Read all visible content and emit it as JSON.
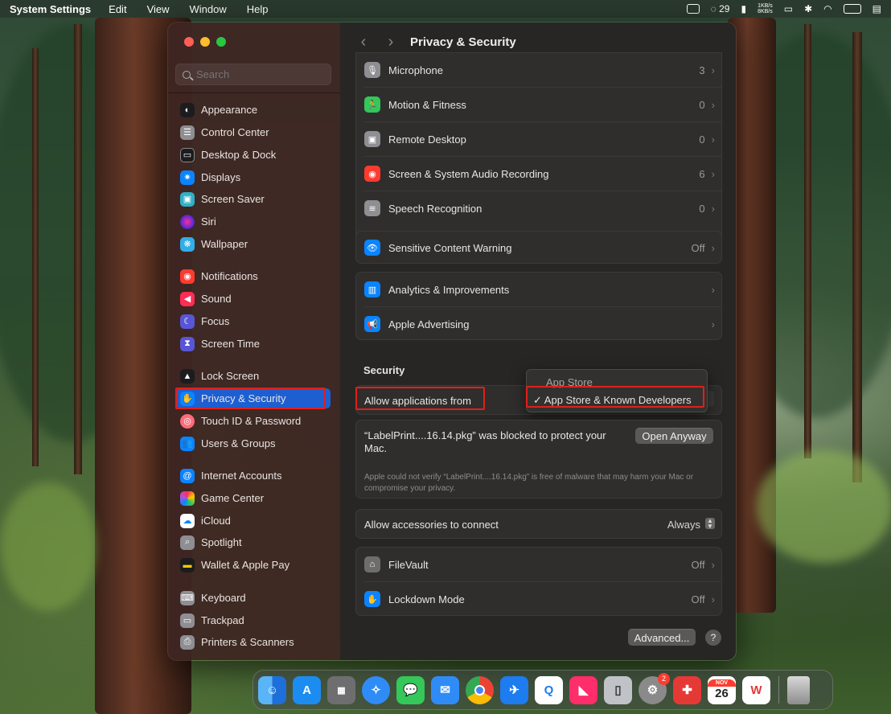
{
  "menubar": {
    "app": "System Settings",
    "menus": [
      "Edit",
      "View",
      "Window",
      "Help"
    ],
    "notif_count": "29",
    "net_up": "1KB/s",
    "net_down": "8KB/s"
  },
  "window": {
    "title": "Privacy & Security"
  },
  "sidebar": {
    "search_placeholder": "Search",
    "items": [
      {
        "label": "Appearance",
        "icon": "appearance-icon",
        "color": "#1c1c1e"
      },
      {
        "label": "Control Center",
        "icon": "control-center-icon",
        "color": "#8e8e93"
      },
      {
        "label": "Desktop & Dock",
        "icon": "desktop-dock-icon",
        "color": "#1c1c1e"
      },
      {
        "label": "Displays",
        "icon": "displays-icon",
        "color": "#0a84ff"
      },
      {
        "label": "Screen Saver",
        "icon": "screen-saver-icon",
        "color": "#30b0c7"
      },
      {
        "label": "Siri",
        "icon": "siri-icon",
        "color": "#5e2bd8"
      },
      {
        "label": "Wallpaper",
        "icon": "wallpaper-icon",
        "color": "#32ade6"
      },
      {
        "label": "Notifications",
        "icon": "notifications-icon",
        "color": "#ff3b30"
      },
      {
        "label": "Sound",
        "icon": "sound-icon",
        "color": "#ff2d55"
      },
      {
        "label": "Focus",
        "icon": "focus-icon",
        "color": "#5856d6"
      },
      {
        "label": "Screen Time",
        "icon": "screen-time-icon",
        "color": "#5856d6"
      },
      {
        "label": "Lock Screen",
        "icon": "lock-screen-icon",
        "color": "#1c1c1e"
      },
      {
        "label": "Privacy & Security",
        "icon": "privacy-hand-icon",
        "color": "#0a84ff"
      },
      {
        "label": "Touch ID & Password",
        "icon": "touch-id-icon",
        "color": "#ff6b7a"
      },
      {
        "label": "Users & Groups",
        "icon": "users-icon",
        "color": "#0a84ff"
      },
      {
        "label": "Internet Accounts",
        "icon": "internet-accounts-icon",
        "color": "#0a84ff"
      },
      {
        "label": "Game Center",
        "icon": "game-center-icon",
        "color": "#e0e0e0"
      },
      {
        "label": "iCloud",
        "icon": "icloud-icon",
        "color": "#ffffff"
      },
      {
        "label": "Spotlight",
        "icon": "spotlight-icon",
        "color": "#8e8e93"
      },
      {
        "label": "Wallet & Apple Pay",
        "icon": "wallet-icon",
        "color": "#1c1c1e"
      },
      {
        "label": "Keyboard",
        "icon": "keyboard-icon",
        "color": "#8e8e93"
      },
      {
        "label": "Trackpad",
        "icon": "trackpad-icon",
        "color": "#8e8e93"
      },
      {
        "label": "Printers & Scanners",
        "icon": "printer-icon",
        "color": "#8e8e93"
      }
    ]
  },
  "privacy": {
    "rows": [
      {
        "label": "Microphone",
        "value": "3",
        "icon": "microphone-icon",
        "color": "#8e8e93"
      },
      {
        "label": "Motion & Fitness",
        "value": "0",
        "icon": "motion-fitness-icon",
        "color": "#34c759"
      },
      {
        "label": "Remote Desktop",
        "value": "0",
        "icon": "remote-desktop-icon",
        "color": "#8e8e93"
      },
      {
        "label": "Screen & System Audio Recording",
        "value": "6",
        "icon": "screen-recording-icon",
        "color": "#ff3b30"
      },
      {
        "label": "Speech Recognition",
        "value": "0",
        "icon": "speech-recognition-icon",
        "color": "#8e8e93"
      }
    ],
    "sensitive": {
      "label": "Sensitive Content Warning",
      "value": "Off"
    },
    "analytics": [
      {
        "label": "Analytics & Improvements",
        "value": ""
      },
      {
        "label": "Apple Advertising",
        "value": ""
      }
    ]
  },
  "security": {
    "section_title": "Security",
    "allow_label": "Allow applications from",
    "options": [
      "App Store",
      "✓ App Store & Known Developers"
    ],
    "blocked_message": "“LabelPrint....16.14.pkg” was blocked to protect your Mac.",
    "open_anyway": "Open Anyway",
    "warning": "Apple could not verify “LabelPrint....16.14.pkg” is free of malware that may harm your Mac or compromise your privacy.",
    "accessories_label": "Allow accessories to connect",
    "accessories_value": "Always",
    "filevault": {
      "label": "FileVault",
      "value": "Off"
    },
    "lockdown": {
      "label": "Lockdown Mode",
      "value": "Off"
    },
    "advanced": "Advanced...",
    "help": "?"
  },
  "dock": {
    "apps": [
      {
        "name": "finder-icon",
        "color": "#1e88e5",
        "glyph": ""
      },
      {
        "name": "app-store-icon",
        "color": "#1c8cf0",
        "glyph": "A"
      },
      {
        "name": "launchpad-icon",
        "color": "#7a7a7a",
        "glyph": ""
      },
      {
        "name": "safari-icon",
        "color": "#2f8cf6",
        "glyph": ""
      },
      {
        "name": "messages-icon",
        "color": "#34c759",
        "glyph": ""
      },
      {
        "name": "mail-icon",
        "color": "#2f8cf6",
        "glyph": ""
      },
      {
        "name": "chrome-icon",
        "color": "#ffffff",
        "glyph": ""
      },
      {
        "name": "testflight-icon",
        "color": "#1c7cf0",
        "glyph": ""
      },
      {
        "name": "quickq-icon",
        "color": "#ffffff",
        "glyph": ""
      },
      {
        "name": "klack-icon",
        "color": "#ff2d6a",
        "glyph": ""
      },
      {
        "name": "simulator-icon",
        "color": "#bfc3c8",
        "glyph": ""
      },
      {
        "name": "system-settings-icon",
        "color": "#8a8a8a",
        "glyph": "",
        "badge": "2"
      },
      {
        "name": "xmind-icon",
        "color": "#e53935",
        "glyph": ""
      },
      {
        "name": "calendar-icon",
        "color": "#ffffff",
        "glyph": "26",
        "month": "NOV"
      },
      {
        "name": "wps-office-icon",
        "color": "#ffffff",
        "glyph": "W"
      }
    ],
    "trash": "trash-icon"
  }
}
